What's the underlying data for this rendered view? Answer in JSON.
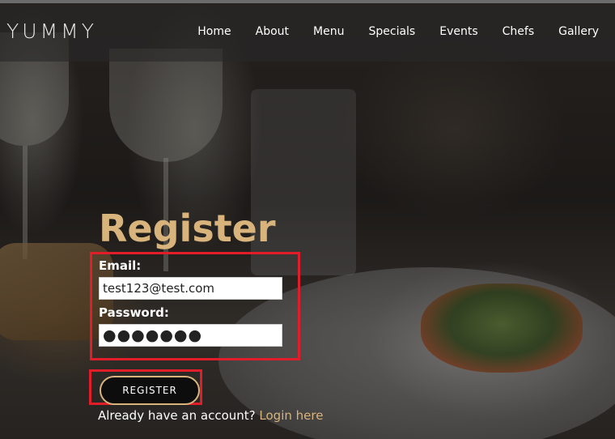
{
  "brand": {
    "logo_text": "YUMMY"
  },
  "nav": {
    "items": [
      {
        "label": "Home"
      },
      {
        "label": "About"
      },
      {
        "label": "Menu"
      },
      {
        "label": "Specials"
      },
      {
        "label": "Events"
      },
      {
        "label": "Chefs"
      },
      {
        "label": "Gallery"
      }
    ]
  },
  "register_form": {
    "title": "Register",
    "email_label": "Email:",
    "email_value": "test123@test.com",
    "password_label": "Password:",
    "password_masked": "●●●●●●●",
    "submit_label": "REGISTER",
    "account_prompt": "Already have an account?",
    "login_link_label": "Login here"
  },
  "colors": {
    "accent_gold": "#d8b47c",
    "highlight_red": "#e11d2a",
    "nav_background": "rgba(40,40,40,0.62)"
  }
}
